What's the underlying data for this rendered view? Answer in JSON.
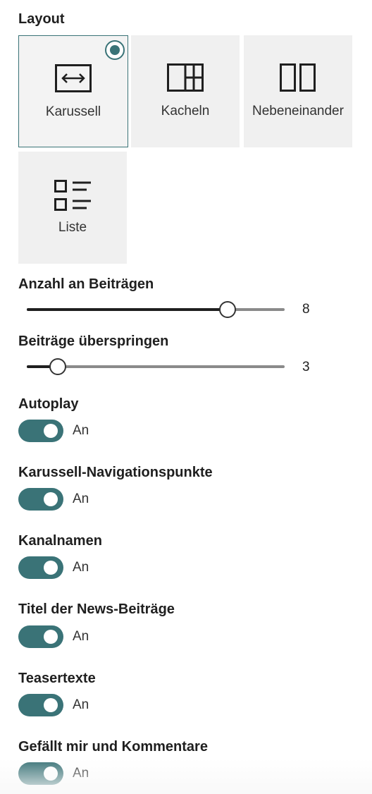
{
  "layout": {
    "label": "Layout",
    "options": [
      {
        "label": "Karussell",
        "icon": "carousel-icon",
        "selected": true
      },
      {
        "label": "Kacheln",
        "icon": "tiles-icon",
        "selected": false
      },
      {
        "label": "Nebeneinander",
        "icon": "side-by-side-icon",
        "selected": false
      },
      {
        "label": "Liste",
        "icon": "list-icon",
        "selected": false
      }
    ]
  },
  "sliders": [
    {
      "label": "Anzahl an Beiträgen",
      "value": "8",
      "fill_fraction": 0.78
    },
    {
      "label": "Beiträge überspringen",
      "value": "3",
      "fill_fraction": 0.12
    }
  ],
  "toggles": [
    {
      "label": "Autoplay",
      "state": "An",
      "on": true
    },
    {
      "label": "Karussell-Navigationspunkte",
      "state": "An",
      "on": true
    },
    {
      "label": "Kanalnamen",
      "state": "An",
      "on": true
    },
    {
      "label": "Titel der News-Beiträge",
      "state": "An",
      "on": true
    },
    {
      "label": "Teasertexte",
      "state": "An",
      "on": true
    },
    {
      "label": "Gefällt mir und Kommentare",
      "state": "An",
      "on": true
    }
  ],
  "colors": {
    "accent": "#3a7377",
    "tile_background": "#f0f0f0",
    "slider_filled": "#1f1f1f",
    "slider_track": "#8a8a8a"
  }
}
